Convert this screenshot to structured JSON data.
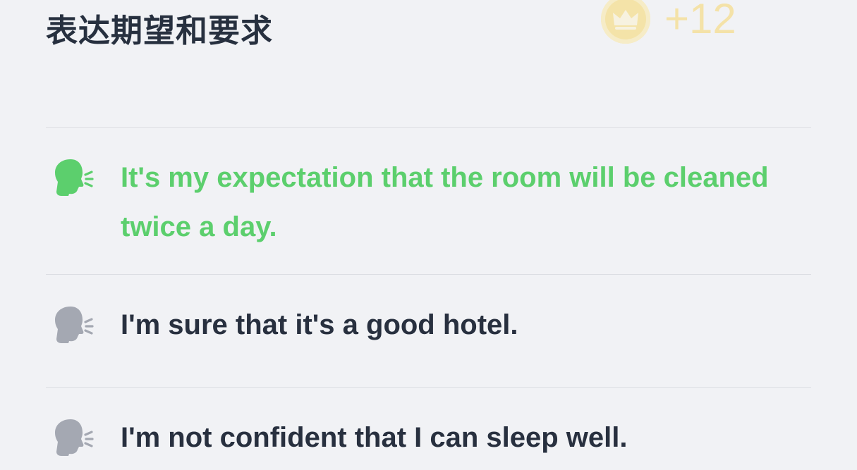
{
  "header": {
    "title": "表达期望和要求",
    "reward": {
      "icon": "crown-coin-icon",
      "text": "+12"
    }
  },
  "options": [
    {
      "text": "It's my expectation that the room will be cleaned twice a day.",
      "state": "active",
      "icon": "speaking-head-icon",
      "color": "#5ccf6d"
    },
    {
      "text": "I'm sure that it's a good hotel.",
      "state": "normal",
      "icon": "speaking-head-icon",
      "color": "#a4a8b2"
    },
    {
      "text": "I'm not confident that I can sleep well.",
      "state": "normal",
      "icon": "speaking-head-icon",
      "color": "#a4a8b2"
    }
  ],
  "colors": {
    "background": "#f1f2f5",
    "title": "#27303f",
    "accent_green": "#5ccf6d",
    "coin": "#f8d86a"
  }
}
